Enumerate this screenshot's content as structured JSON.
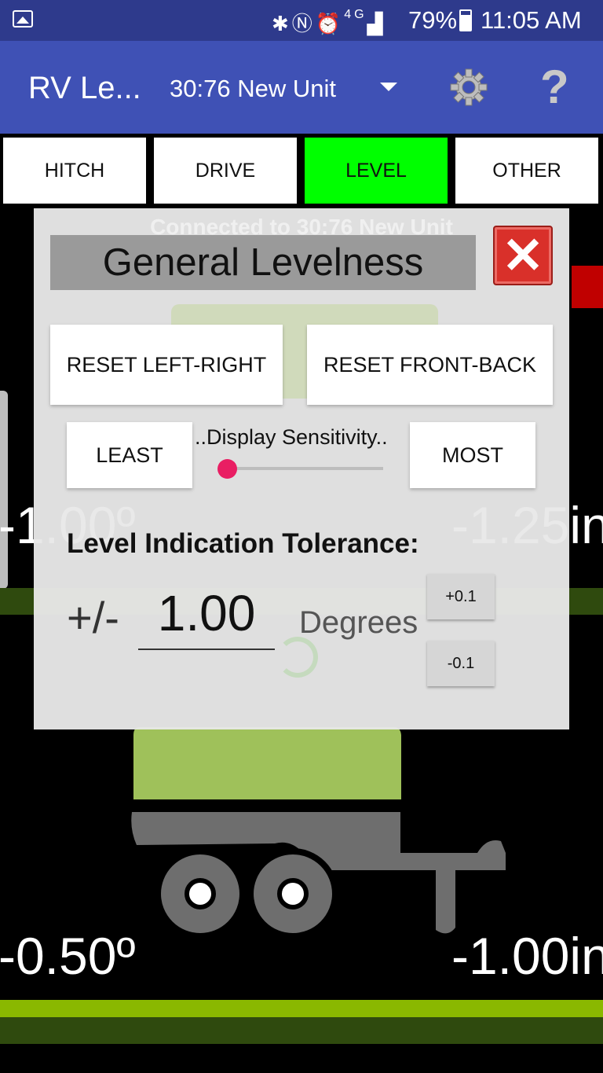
{
  "status_bar": {
    "battery": "79%",
    "time": "11:05 AM",
    "network": "4G"
  },
  "app_bar": {
    "title": "RV Le...",
    "device": "30:76 New Unit"
  },
  "tabs": [
    "HITCH",
    "DRIVE",
    "LEVEL",
    "OTHER"
  ],
  "active_tab": "LEVEL",
  "background_readings": {
    "top_left": "-1.00º",
    "top_right": "-1.25in",
    "bottom_left": "-0.50º",
    "bottom_right": "-1.00in"
  },
  "dialog": {
    "connected_text": "Connected to 30:76 New Unit",
    "title": "General Levelness",
    "reset_left_right": "RESET LEFT-RIGHT",
    "reset_front_back": "RESET FRONT-BACK",
    "least": "LEAST",
    "sensitivity_label": "..Display Sensitivity..",
    "most": "MOST",
    "sensitivity_level": 0.05,
    "tolerance_label": "Level Indication Tolerance:",
    "plus_minus": "+/-",
    "tolerance_value": "1.00",
    "tolerance_units": "Degrees",
    "increment": "+0.1",
    "decrement": "-0.1"
  },
  "colors": {
    "status_bar": "#2e3a8c",
    "app_bar": "#3f51b5",
    "active_tab": "#00ff00",
    "trailer": "#6e6e6e",
    "trailer_top": "#9fc15a",
    "close_button": "#d9302a",
    "slider_thumb": "#e91e63"
  }
}
